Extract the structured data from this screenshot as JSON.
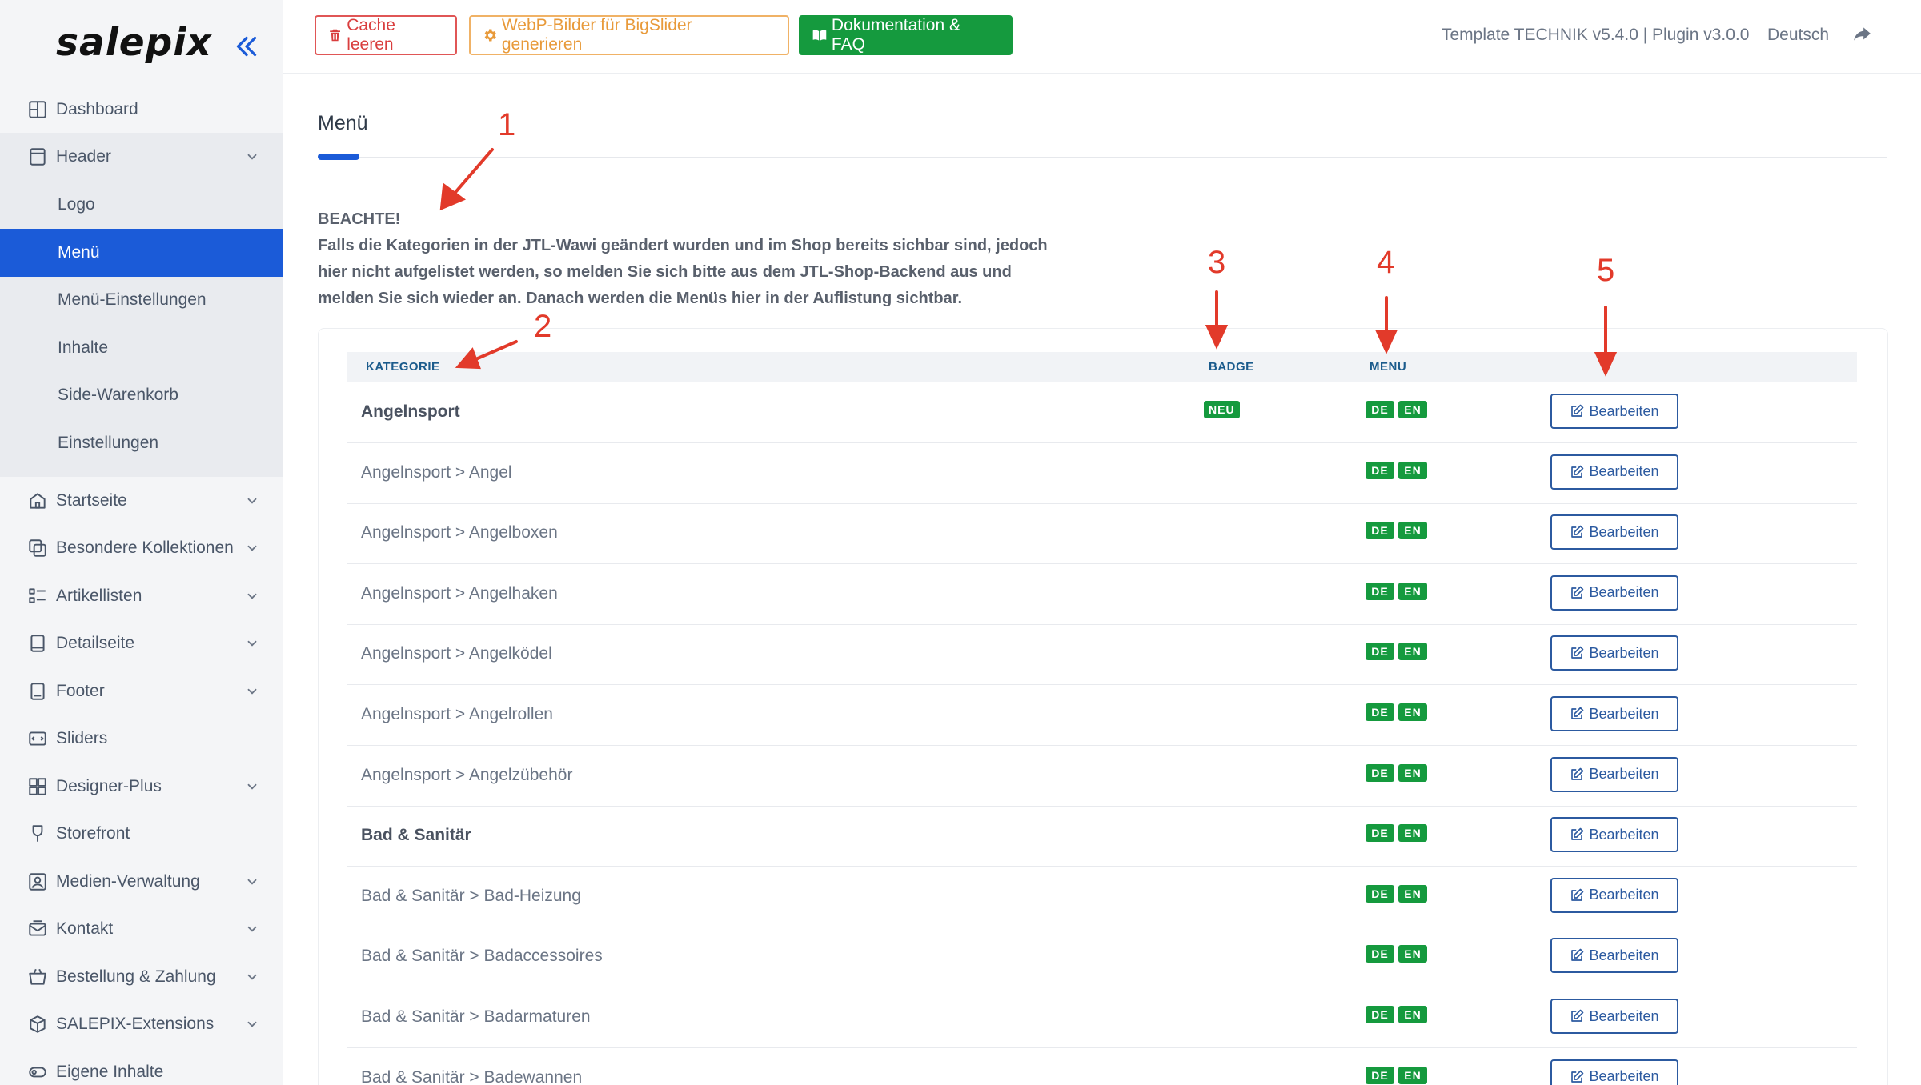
{
  "brand": {
    "logo": "salepix"
  },
  "sidebar": {
    "items": [
      {
        "label": "Dashboard",
        "icon": "dashboard-icon",
        "chevron": false
      },
      {
        "label": "Header",
        "icon": "header-icon",
        "chevron": true
      },
      {
        "label": "Startseite",
        "icon": "home-icon",
        "chevron": true
      },
      {
        "label": "Besondere Kollektionen",
        "icon": "collections-icon",
        "chevron": true
      },
      {
        "label": "Artikellisten",
        "icon": "list-icon",
        "chevron": true
      },
      {
        "label": "Detailseite",
        "icon": "detail-icon",
        "chevron": true
      },
      {
        "label": "Footer",
        "icon": "footer-icon",
        "chevron": true
      },
      {
        "label": "Sliders",
        "icon": "slider-icon",
        "chevron": false
      },
      {
        "label": "Designer-Plus",
        "icon": "designer-icon",
        "chevron": true
      },
      {
        "label": "Storefront",
        "icon": "storefront-icon",
        "chevron": false
      },
      {
        "label": "Medien-Verwaltung",
        "icon": "media-icon",
        "chevron": true
      },
      {
        "label": "Kontakt",
        "icon": "contact-icon",
        "chevron": true
      },
      {
        "label": "Bestellung & Zahlung",
        "icon": "cart-icon",
        "chevron": true
      },
      {
        "label": "SALEPIX-Extensions",
        "icon": "extensions-icon",
        "chevron": true
      },
      {
        "label": "Eigene Inhalte",
        "icon": "custom-content-icon",
        "chevron": false
      }
    ],
    "submenu": [
      {
        "label": "Logo",
        "active": false
      },
      {
        "label": "Menü",
        "active": true
      },
      {
        "label": "Menü-Einstellungen",
        "active": false
      },
      {
        "label": "Inhalte",
        "active": false
      },
      {
        "label": "Side-Warenkorb",
        "active": false
      },
      {
        "label": "Einstellungen",
        "active": false
      }
    ]
  },
  "toolbar": {
    "cache_label": "Cache leeren",
    "webp_label": "WebP-Bilder für BigSlider generieren",
    "docs_label": "Dokumentation & FAQ",
    "version": "Template TECHNIK v5.4.0 | Plugin v3.0.0",
    "language": "Deutsch"
  },
  "page": {
    "title": "Menü",
    "notice_heading": "BEACHTE!",
    "notice_text": "Falls die Kategorien in der JTL-Wawi geändert wurden und im Shop bereits sichbar sind, jedoch hier nicht aufgelistet werden, so melden Sie sich bitte aus dem JTL-Shop-Backend aus und melden Sie sich wieder an. Danach werden die Menüs hier in der Auflistung sichtbar."
  },
  "table": {
    "headers": {
      "category": "KATEGORIE",
      "badge": "BADGE",
      "menu": "MENU"
    },
    "lang_de": "DE",
    "lang_en": "EN",
    "edit_label": "Bearbeiten",
    "rows": [
      {
        "category": "Angelnsport",
        "bold": true,
        "badge": "NEU"
      },
      {
        "category": "Angelnsport > Angel",
        "bold": false,
        "badge": ""
      },
      {
        "category": "Angelnsport > Angelboxen",
        "bold": false,
        "badge": ""
      },
      {
        "category": "Angelnsport > Angelhaken",
        "bold": false,
        "badge": ""
      },
      {
        "category": "Angelnsport > Angelködel",
        "bold": false,
        "badge": ""
      },
      {
        "category": "Angelnsport > Angelrollen",
        "bold": false,
        "badge": ""
      },
      {
        "category": "Angelnsport > Angelzübehör",
        "bold": false,
        "badge": ""
      },
      {
        "category": "Bad & Sanitär",
        "bold": true,
        "badge": ""
      },
      {
        "category": "Bad & Sanitär > Bad-Heizung",
        "bold": false,
        "badge": ""
      },
      {
        "category": "Bad & Sanitär > Badaccessoires",
        "bold": false,
        "badge": ""
      },
      {
        "category": "Bad & Sanitär > Badarmaturen",
        "bold": false,
        "badge": ""
      },
      {
        "category": "Bad & Sanitär > Badewannen",
        "bold": false,
        "badge": ""
      }
    ]
  },
  "annotations": {
    "labels": [
      "1",
      "2",
      "3",
      "4",
      "5"
    ],
    "color": "#e23a2a"
  }
}
